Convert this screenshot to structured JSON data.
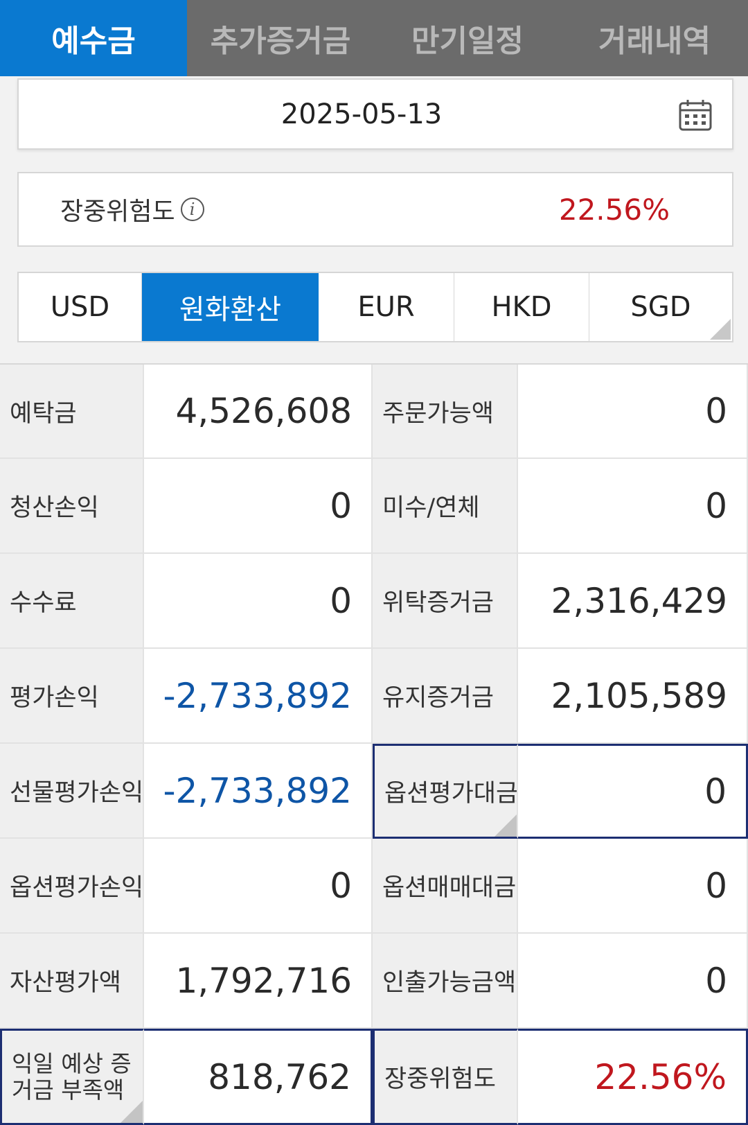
{
  "tabs": [
    "예수금",
    "추가증거금",
    "만기일정",
    "거래내역"
  ],
  "date": "2025-05-13",
  "risk": {
    "label": "장중위험도",
    "value": "22.56%"
  },
  "currencies": [
    "USD",
    "원화환산",
    "EUR",
    "HKD",
    "SGD"
  ],
  "rows": [
    {
      "l1": "예탁금",
      "v1": "4,526,608",
      "l2": "주문가능액",
      "v2": "0"
    },
    {
      "l1": "청산손익",
      "v1": "0",
      "l2": "미수/연체",
      "v2": "0"
    },
    {
      "l1": "수수료",
      "v1": "0",
      "l2": "위탁증거금",
      "v2": "2,316,429"
    },
    {
      "l1": "평가손익",
      "v1": "-2,733,892",
      "l2": "유지증거금",
      "v2": "2,105,589"
    },
    {
      "l1": "선물평가손익",
      "v1": "-2,733,892",
      "l2": "옵션평가대금",
      "v2": "0"
    },
    {
      "l1": "옵션평가손익",
      "v1": "0",
      "l2": "옵션매매대금",
      "v2": "0"
    },
    {
      "l1": "자산평가액",
      "v1": "1,792,716",
      "l2": "인출가능금액",
      "v2": "0"
    },
    {
      "l1": "익일 예상 증거금 부족액",
      "v1": "818,762",
      "l2": "장중위험도",
      "v2": "22.56%"
    }
  ],
  "colors": {
    "accent": "#0a79d0",
    "negative": "#0e55a6",
    "risk": "#c0171e"
  }
}
